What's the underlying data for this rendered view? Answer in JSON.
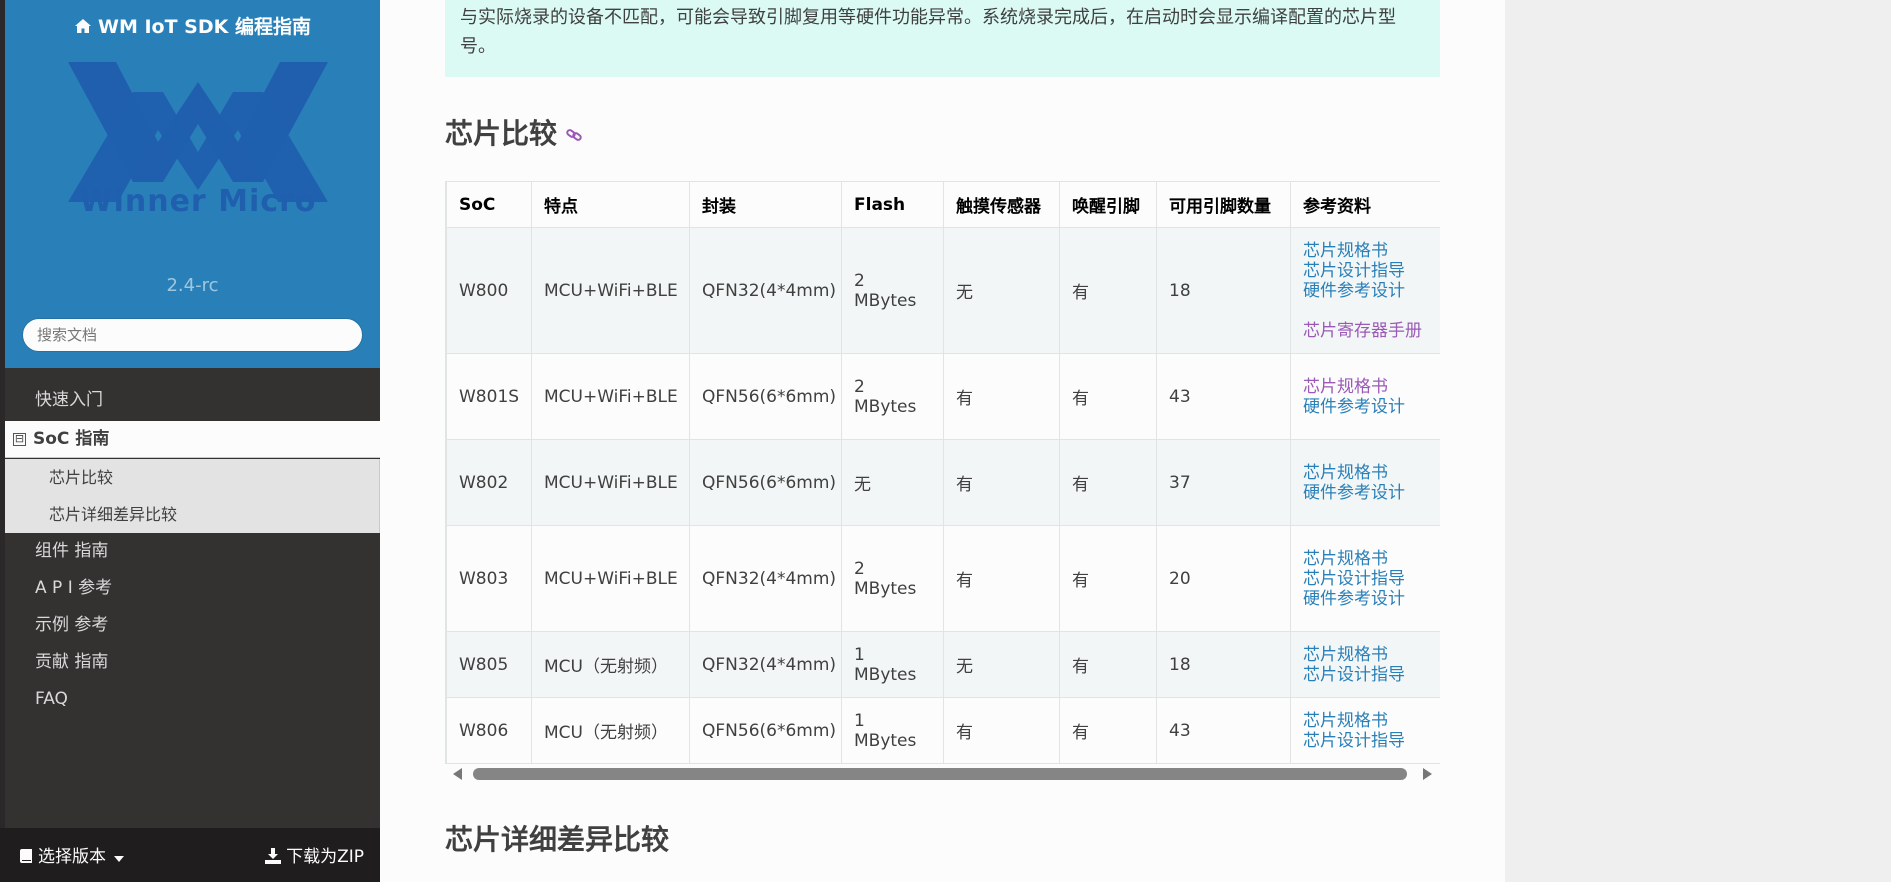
{
  "sidebar": {
    "title": "WM IoT SDK 编程指南",
    "logo_text": "Winner Micro",
    "version": "2.4-rc",
    "search_placeholder": "搜索文档",
    "nav": [
      {
        "label": "快速入门"
      },
      {
        "label": "SoC 指南",
        "toggle": "⊟"
      },
      {
        "label": "芯片比较"
      },
      {
        "label": "芯片详细差异比较"
      },
      {
        "label": "组件 指南"
      },
      {
        "label": "A P I 参考"
      },
      {
        "label": "示例 参考"
      },
      {
        "label": "贡献 指南"
      },
      {
        "label": "FAQ"
      }
    ],
    "footer": {
      "version_select": "选择版本",
      "download": "下载为ZIP"
    }
  },
  "main": {
    "note_text": "与实际烧录的设备不匹配，可能会导致引脚复用等硬件功能异常。系统烧录完成后，在启动时会显示编译配置的芯片型号。",
    "section1_title": "芯片比较",
    "section2_title": "芯片详细差异比较",
    "table": {
      "headers": [
        "SoC",
        "特点",
        "封装",
        "Flash",
        "触摸传感器",
        "唤醒引脚",
        "可用引脚数量",
        "参考资料"
      ],
      "rows": [
        {
          "soc": "W800",
          "feature": "MCU+WiFi+BLE",
          "package": "QFN32(4*4mm)",
          "flash": "2 MBytes",
          "touch": "无",
          "wake": "有",
          "pins": "18",
          "refs": [
            "芯片规格书",
            "芯片设计指导",
            "硬件参考设计",
            "芯片寄存器手册"
          ]
        },
        {
          "soc": "W801S",
          "feature": "MCU+WiFi+BLE",
          "package": "QFN56(6*6mm)",
          "flash": "2 MBytes",
          "touch": "有",
          "wake": "有",
          "pins": "43",
          "refs": [
            "芯片规格书",
            "硬件参考设计"
          ]
        },
        {
          "soc": "W802",
          "feature": "MCU+WiFi+BLE",
          "package": "QFN56(6*6mm)",
          "flash": "无",
          "touch": "有",
          "wake": "有",
          "pins": "37",
          "refs": [
            "芯片规格书",
            "硬件参考设计"
          ]
        },
        {
          "soc": "W803",
          "feature": "MCU+WiFi+BLE",
          "package": "QFN32(4*4mm)",
          "flash": "2 MBytes",
          "touch": "有",
          "wake": "有",
          "pins": "20",
          "refs": [
            "芯片规格书",
            "芯片设计指导",
            "硬件参考设计"
          ]
        },
        {
          "soc": "W805",
          "feature": "MCU（无射频）",
          "package": "QFN32(4*4mm)",
          "flash": "1 MBytes",
          "touch": "无",
          "wake": "有",
          "pins": "18",
          "refs": [
            "芯片规格书",
            "芯片设计指导"
          ]
        },
        {
          "soc": "W806",
          "feature": "MCU（无射频）",
          "package": "QFN56(6*6mm)",
          "flash": "1 MBytes",
          "touch": "有",
          "wake": "有",
          "pins": "43",
          "refs": [
            "芯片规格书",
            "芯片设计指导"
          ]
        }
      ]
    }
  },
  "colors": {
    "sidebar_top": "#2980b9",
    "sidebar_bg": "#343131",
    "link": "#2980b9",
    "link_visited": "#9b59b6",
    "note_bg": "#dbfaf4"
  },
  "icons": {
    "home": "home-icon",
    "book": "book-icon",
    "download": "download-icon",
    "anchor": "link-icon"
  }
}
